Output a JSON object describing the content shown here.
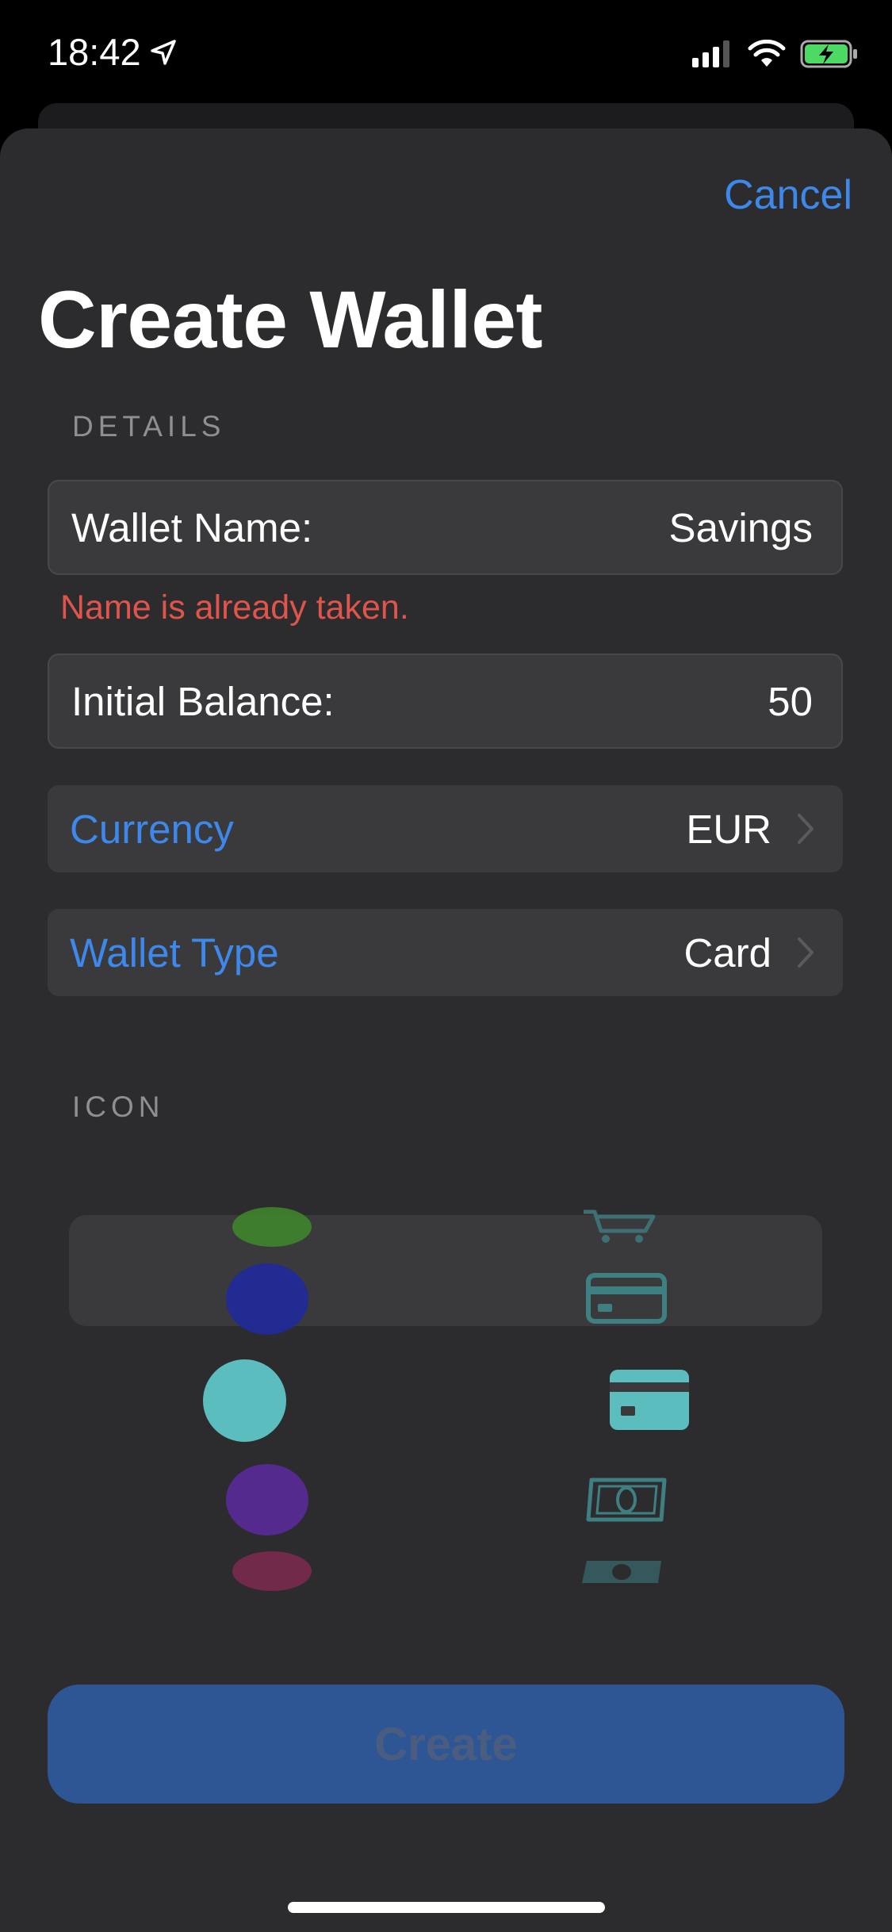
{
  "status_bar": {
    "time": "18:42",
    "icons": [
      "location-arrow-icon",
      "cellular-signal-icon",
      "wifi-icon",
      "battery-charging-icon"
    ]
  },
  "sheet": {
    "cancel_label": "Cancel",
    "title": "Create Wallet",
    "details_header": "DETAILS",
    "wallet_name": {
      "label": "Wallet Name:",
      "value": "Savings"
    },
    "name_error": "Name is already taken.",
    "initial_balance": {
      "label": "Initial Balance:",
      "value": "50"
    },
    "currency": {
      "label": "Currency",
      "value": "EUR"
    },
    "wallet_type": {
      "label": "Wallet Type",
      "value": "Card"
    },
    "icon_header": "ICON",
    "color_picker": {
      "options": [
        "green",
        "blue",
        "teal",
        "purple",
        "pink"
      ],
      "selected": "teal",
      "colors": {
        "green": "#3f8a2a",
        "blue": "#1f2a9a",
        "teal": "#5bbdbd",
        "purple": "#5a2a9a",
        "pink": "#8a2a55"
      }
    },
    "icon_picker": {
      "options": [
        "cart-icon",
        "card-outline-icon",
        "card-filled-icon",
        "cash-icon",
        "cash-icon"
      ],
      "selected": "card-filled-icon",
      "accent_color": "#5bbdbd"
    },
    "create_label": "Create"
  },
  "colors": {
    "accent": "#3d88ea",
    "error": "#e0554b",
    "sheet_background": "#2c2c2e",
    "row_background": "#3a3a3c",
    "create_button": "#2f5694"
  }
}
